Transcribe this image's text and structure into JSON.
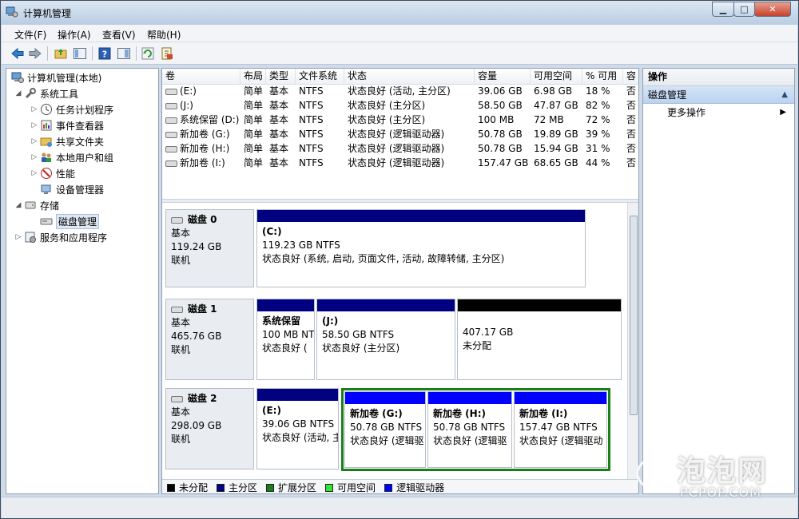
{
  "window": {
    "title": "计算机管理"
  },
  "menu": [
    "文件(F)",
    "操作(A)",
    "查看(V)",
    "帮助(H)"
  ],
  "toolbar_icons": [
    "back-icon",
    "forward-icon",
    "up-folder-icon",
    "show-hide-tree-icon",
    "help-icon",
    "properties-icon",
    "refresh-icon",
    "export-icon"
  ],
  "tree": {
    "root": "计算机管理(本地)",
    "system_tools": "系统工具",
    "task_scheduler": "任务计划程序",
    "event_viewer": "事件查看器",
    "shared_folders": "共享文件夹",
    "local_users": "本地用户和组",
    "performance": "性能",
    "device_manager": "设备管理器",
    "storage": "存储",
    "disk_management": "磁盘管理",
    "services": "服务和应用程序"
  },
  "volume_table": {
    "headers": [
      "卷",
      "布局",
      "类型",
      "文件系统",
      "状态",
      "容量",
      "可用空间",
      "% 可用",
      "容"
    ],
    "rows": [
      [
        "(E:)",
        "简单",
        "基本",
        "NTFS",
        "状态良好 (活动, 主分区)",
        "39.06 GB",
        "6.98 GB",
        "18 %",
        "否"
      ],
      [
        "(J:)",
        "简单",
        "基本",
        "NTFS",
        "状态良好 (主分区)",
        "58.50 GB",
        "47.87 GB",
        "82 %",
        "否"
      ],
      [
        "系统保留 (D:)",
        "简单",
        "基本",
        "NTFS",
        "状态良好 (主分区)",
        "100 MB",
        "72 MB",
        "72 %",
        "否"
      ],
      [
        "新加卷 (G:)",
        "简单",
        "基本",
        "NTFS",
        "状态良好 (逻辑驱动器)",
        "50.78 GB",
        "19.89 GB",
        "39 %",
        "否"
      ],
      [
        "新加卷 (H:)",
        "简单",
        "基本",
        "NTFS",
        "状态良好 (逻辑驱动器)",
        "50.78 GB",
        "15.94 GB",
        "31 %",
        "否"
      ],
      [
        "新加卷 (I:)",
        "简单",
        "基本",
        "NTFS",
        "状态良好 (逻辑驱动器)",
        "157.47 GB",
        "68.65 GB",
        "44 %",
        "否"
      ]
    ]
  },
  "disks": {
    "d0": {
      "name": "磁盘 0",
      "type": "基本",
      "size": "119.24 GB",
      "status": "联机",
      "p0": {
        "name": "(C:)",
        "size": "119.23 GB NTFS",
        "status": "状态良好 (系统, 启动, 页面文件, 活动, 故障转储, 主分区)"
      }
    },
    "d1": {
      "name": "磁盘 1",
      "type": "基本",
      "size": "465.76 GB",
      "status": "联机",
      "p0": {
        "name": "系统保留",
        "size": "100 MB NTFS",
        "status": "状态良好 ("
      },
      "p1": {
        "name": "(J:)",
        "size": "58.50 GB NTFS",
        "status": "状态良好 (主分区)"
      },
      "p2": {
        "size": "407.17 GB",
        "status": "未分配"
      }
    },
    "d2": {
      "name": "磁盘 2",
      "type": "基本",
      "size": "298.09 GB",
      "status": "联机",
      "p0": {
        "name": "(E:)",
        "size": "39.06 GB NTFS",
        "status": "状态良好 (活动, 主"
      },
      "p1": {
        "name": "新加卷 (G:)",
        "size": "50.78 GB NTFS",
        "status": "状态良好 (逻辑驱"
      },
      "p2": {
        "name": "新加卷 (H:)",
        "size": "50.78 GB NTFS",
        "status": "状态良好 (逻辑驱"
      },
      "p3": {
        "name": "新加卷 (I:)",
        "size": "157.47 GB NTFS",
        "status": "状态良好 (逻辑驱动"
      }
    }
  },
  "legend": {
    "unallocated": "未分配",
    "primary": "主分区",
    "extended": "扩展分区",
    "free": "可用空间",
    "logical": "逻辑驱动器"
  },
  "colors": {
    "unallocated": "#000000",
    "primary": "#000080",
    "extended": "#1a7f1a",
    "free": "#33e633",
    "logical": "#0000ff"
  },
  "actions": {
    "header": "操作",
    "section": "磁盘管理",
    "more": "更多操作"
  },
  "watermark": {
    "cn": "泡泡网",
    "en": "PCPOP.COM"
  }
}
